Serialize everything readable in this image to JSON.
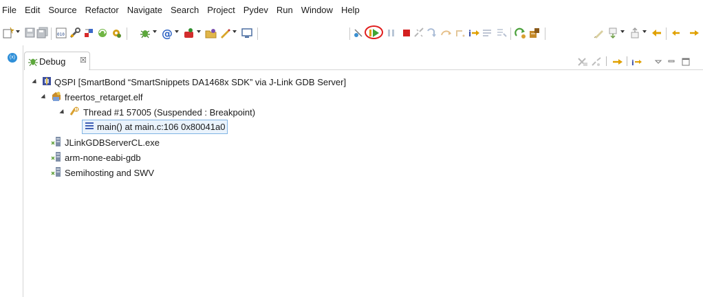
{
  "menu": [
    "File",
    "Edit",
    "Source",
    "Refactor",
    "Navigate",
    "Search",
    "Project",
    "Pydev",
    "Run",
    "Window",
    "Help"
  ],
  "toolbar": {
    "icons": [
      "new-file-icon",
      "save-icon",
      "save-all-icon",
      "open-binary-icon",
      "wrench-icon",
      "build-icon",
      "sync-icon",
      "debug-icon",
      "at-icon",
      "external-tools-icon",
      "open-type-icon",
      "pencil-icon",
      "console-icon",
      "skip-breakpoints-icon",
      "resume-icon",
      "suspend-icon",
      "terminate-icon",
      "disconnect-icon",
      "step-into-icon",
      "step-over-icon",
      "step-return-icon",
      "instruction-stepping-icon",
      "drop-to-frame-icon",
      "restart-icon",
      "jar-icon",
      "annotate-icon",
      "next-annotation-icon",
      "previous-annotation-icon",
      "back-icon"
    ],
    "highlighted": "resume-icon",
    "colors": {
      "highlight_ring": "#e01e1e",
      "resume": "#3fa535"
    }
  },
  "view": {
    "tab_label": "Debug",
    "tab_close": "☒",
    "toolbar_icons": [
      "remove-all-terminated-icon",
      "use-step-filters-icon",
      "step-arrow-icon",
      "step-into-arrow-icon",
      "view-menu-icon",
      "minimize-icon",
      "maximize-icon"
    ]
  },
  "tree": {
    "launch": "QSPI [SmartBond “SmartSnippets DA1468x SDK” via J-Link GDB Server]",
    "target": "freertos_retarget.elf",
    "thread": "Thread #1 57005 (Suspended : Breakpoint)",
    "frame": "main() at main.c:106 0x80041a0",
    "processes": [
      "JLinkGDBServerCL.exe",
      "arm-none-eabi-gdb",
      "Semihosting and SWV"
    ]
  },
  "colors": {
    "selection_bg": "#eaf3fc",
    "selection_border": "#7fb3e4",
    "perspective": "#2f8fd8"
  }
}
